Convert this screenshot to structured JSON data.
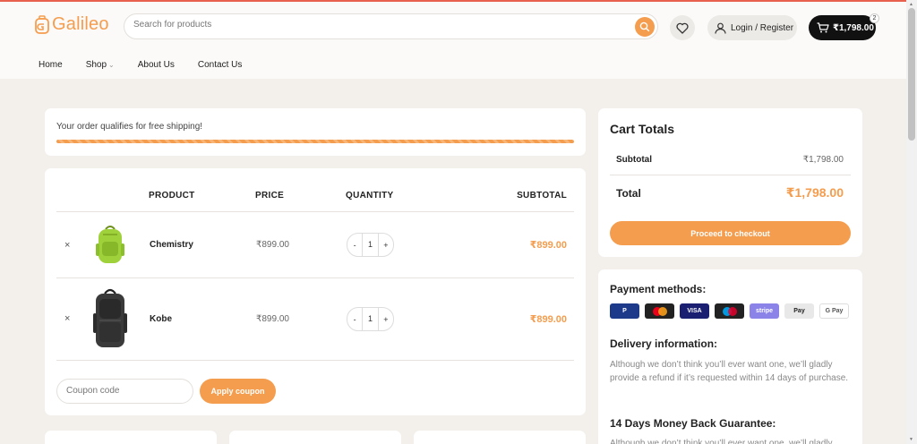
{
  "header": {
    "logo_text": "Galileo",
    "search_placeholder": "Search for products",
    "login_label": "Login / Register",
    "cart_total": "₹1,798.00",
    "cart_count": "2"
  },
  "nav": [
    {
      "label": "Home"
    },
    {
      "label": "Shop"
    },
    {
      "label": "About Us"
    },
    {
      "label": "Contact Us"
    }
  ],
  "shipping": {
    "message": "Your order qualifies for free shipping!",
    "progress": 1.0
  },
  "cart_table": {
    "headers": {
      "product": "PRODUCT",
      "price": "PRICE",
      "quantity": "QUANTITY",
      "subtotal": "SUBTOTAL"
    },
    "rows": [
      {
        "remove": "×",
        "name": "Chemistry",
        "price": "₹899.00",
        "qty": "1",
        "subtotal": "₹899.00",
        "image": "green-backpack"
      },
      {
        "remove": "×",
        "name": "Kobe",
        "price": "₹899.00",
        "qty": "1",
        "subtotal": "₹899.00",
        "image": "black-backpack"
      }
    ],
    "qty_minus": "-",
    "qty_plus": "+",
    "coupon_placeholder": "Coupon code",
    "apply_label": "Apply coupon"
  },
  "totals": {
    "title": "Cart Totals",
    "subtotal_label": "Subtotal",
    "subtotal_value": "₹1,798.00",
    "total_label": "Total",
    "total_value": "₹1,798.00",
    "checkout_label": "Proceed to checkout"
  },
  "info": {
    "payment_title": "Payment methods:",
    "payment_methods": [
      {
        "name": "paypal",
        "label": "P",
        "color": "#1d3a8a"
      },
      {
        "name": "mastercard",
        "label": "",
        "color": "#222222"
      },
      {
        "name": "visa",
        "label": "VISA",
        "color": "#1a1f71"
      },
      {
        "name": "maestro",
        "label": "",
        "color": "#222222"
      },
      {
        "name": "stripe",
        "label": "stripe",
        "color": "#8b83e8"
      },
      {
        "name": "apple-pay",
        "label": "Pay",
        "color": "#e8e8e8"
      },
      {
        "name": "google-pay",
        "label": "G Pay",
        "color": "#ffffff"
      }
    ],
    "delivery_title": "Delivery information:",
    "delivery_text": "Although we don’t think you’ll ever want one, we’ll gladly provide a refund if it’s requested within 14 days of purchase.",
    "guarantee_title": "14 Days Money Back Guarantee:",
    "guarantee_text": "Although we don’t think you’ll ever want one, we’ll gladly"
  },
  "colors": {
    "accent": "#f59d4e",
    "dark": "#111111",
    "background": "#f3f0ec"
  }
}
